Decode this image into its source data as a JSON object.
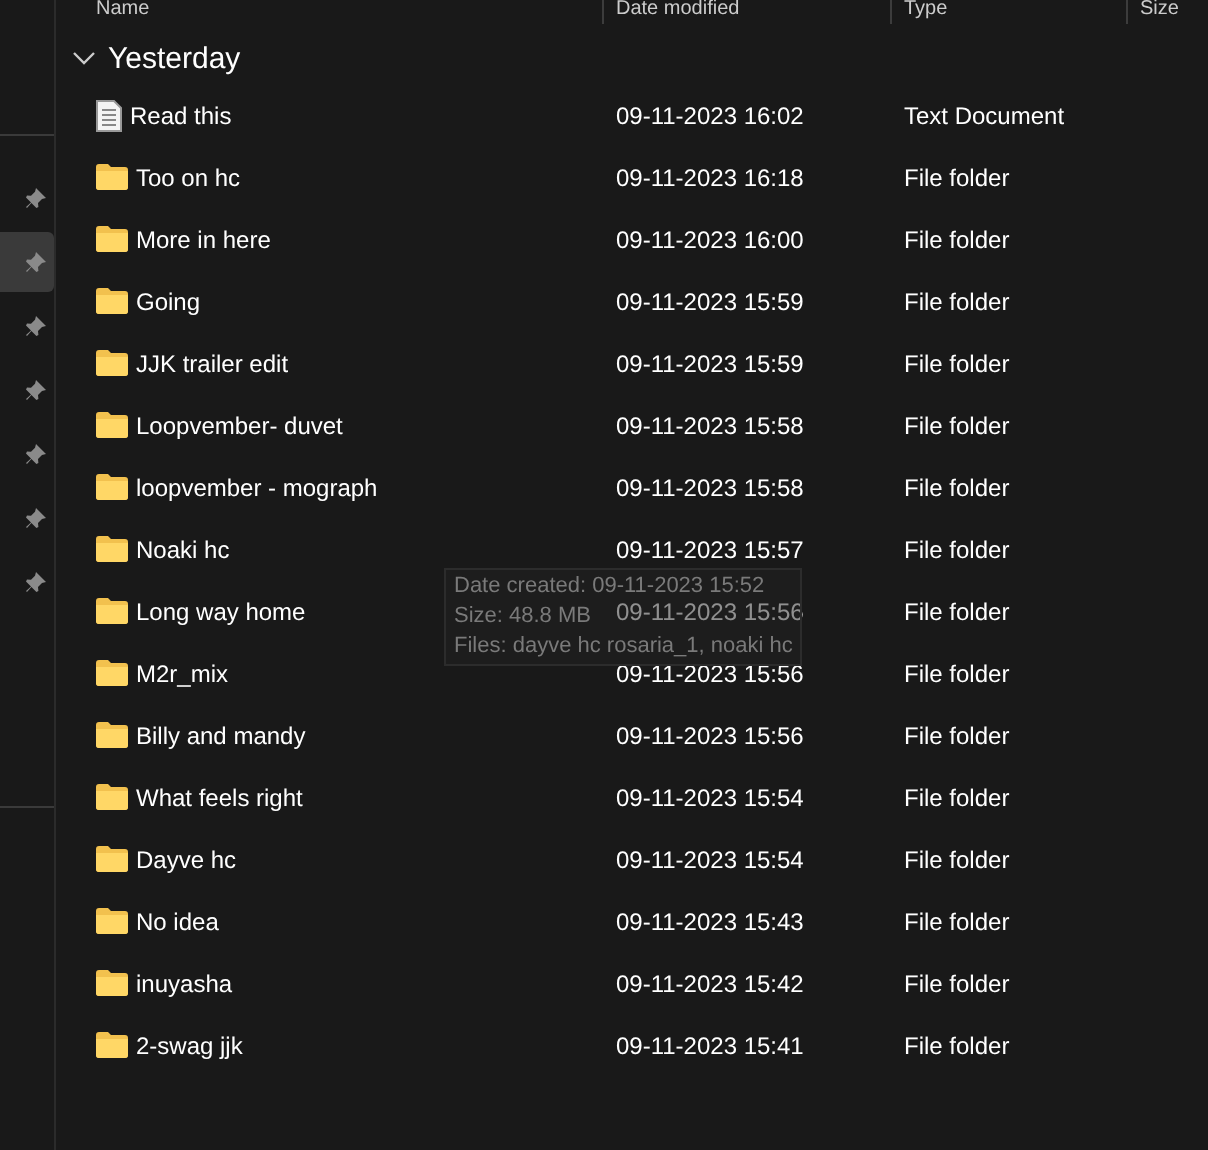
{
  "columns": [
    {
      "label": "Name"
    },
    {
      "label": "Date modified"
    },
    {
      "label": "Type"
    },
    {
      "label": "Size"
    }
  ],
  "sidebar": {
    "pins": [
      {
        "selected": false
      },
      {
        "selected": true
      },
      {
        "selected": false
      },
      {
        "selected": false
      },
      {
        "selected": false
      },
      {
        "selected": false
      },
      {
        "selected": false
      }
    ]
  },
  "group": {
    "label": "Yesterday",
    "expanded": true
  },
  "files": [
    {
      "kind": "text",
      "name": "Read this",
      "date": "09-11-2023 16:02",
      "type": "Text Document"
    },
    {
      "kind": "folder",
      "name": "Too on hc",
      "date": "09-11-2023 16:18",
      "type": "File folder"
    },
    {
      "kind": "folder",
      "name": "More in here",
      "date": "09-11-2023 16:00",
      "type": "File folder"
    },
    {
      "kind": "folder",
      "name": "Going",
      "date": "09-11-2023 15:59",
      "type": "File folder"
    },
    {
      "kind": "folder",
      "name": "JJK trailer edit",
      "date": "09-11-2023 15:59",
      "type": "File folder"
    },
    {
      "kind": "folder",
      "name": "Loopvember- duvet",
      "date": "09-11-2023 15:58",
      "type": "File folder"
    },
    {
      "kind": "folder",
      "name": "loopvember - mograph",
      "date": "09-11-2023 15:58",
      "type": "File folder"
    },
    {
      "kind": "folder",
      "name": "Noaki hc",
      "date": "09-11-2023 15:57",
      "type": "File folder"
    },
    {
      "kind": "folder",
      "name": "Long way home",
      "date": "09-11-2023 15:56",
      "type": "File folder"
    },
    {
      "kind": "folder",
      "name": "M2r_mix",
      "date": "09-11-2023 15:56",
      "type": "File folder"
    },
    {
      "kind": "folder",
      "name": "Billy and mandy",
      "date": "09-11-2023 15:56",
      "type": "File folder"
    },
    {
      "kind": "folder",
      "name": "What feels right",
      "date": "09-11-2023 15:54",
      "type": "File folder"
    },
    {
      "kind": "folder",
      "name": "Dayve hc",
      "date": "09-11-2023 15:54",
      "type": "File folder"
    },
    {
      "kind": "folder",
      "name": "No idea",
      "date": "09-11-2023 15:43",
      "type": "File folder"
    },
    {
      "kind": "folder",
      "name": "inuyasha",
      "date": "09-11-2023 15:42",
      "type": "File folder"
    },
    {
      "kind": "folder",
      "name": "2-swag jjk",
      "date": "09-11-2023 15:41",
      "type": "File folder"
    }
  ],
  "tooltip": {
    "lines": [
      "Date created: 09-11-2023 15:52",
      "Size: 48.8 MB",
      "Files: dayve hc rosaria_1, noaki hc"
    ]
  }
}
